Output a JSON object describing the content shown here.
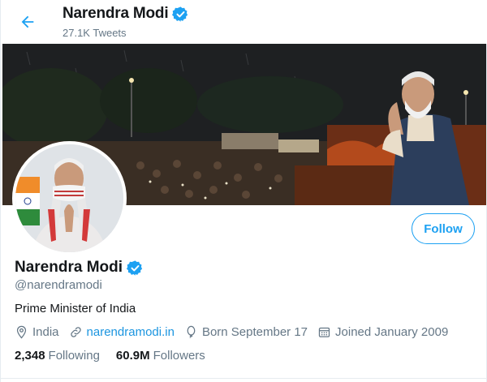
{
  "header": {
    "name": "Narendra Modi",
    "tweet_count": "27.1K Tweets"
  },
  "profile": {
    "name": "Narendra Modi",
    "handle": "@narendramodi",
    "bio": "Prime Minister of India",
    "location": "India",
    "website": "narendramodi.in",
    "birthday": "Born September 17",
    "joined": "Joined January 2009",
    "following_count": "2,348",
    "following_label": "Following",
    "followers_count": "60.9M",
    "followers_label": "Followers",
    "follow_button": "Follow"
  },
  "icons": {
    "back": "arrow-left-icon",
    "verified": "verified-badge-icon",
    "location": "location-pin-icon",
    "link": "link-icon",
    "birthday": "balloon-icon",
    "calendar": "calendar-icon"
  },
  "colors": {
    "accent": "#1da1f2",
    "link": "#1b95e0",
    "muted": "#657786",
    "text": "#14171a"
  }
}
